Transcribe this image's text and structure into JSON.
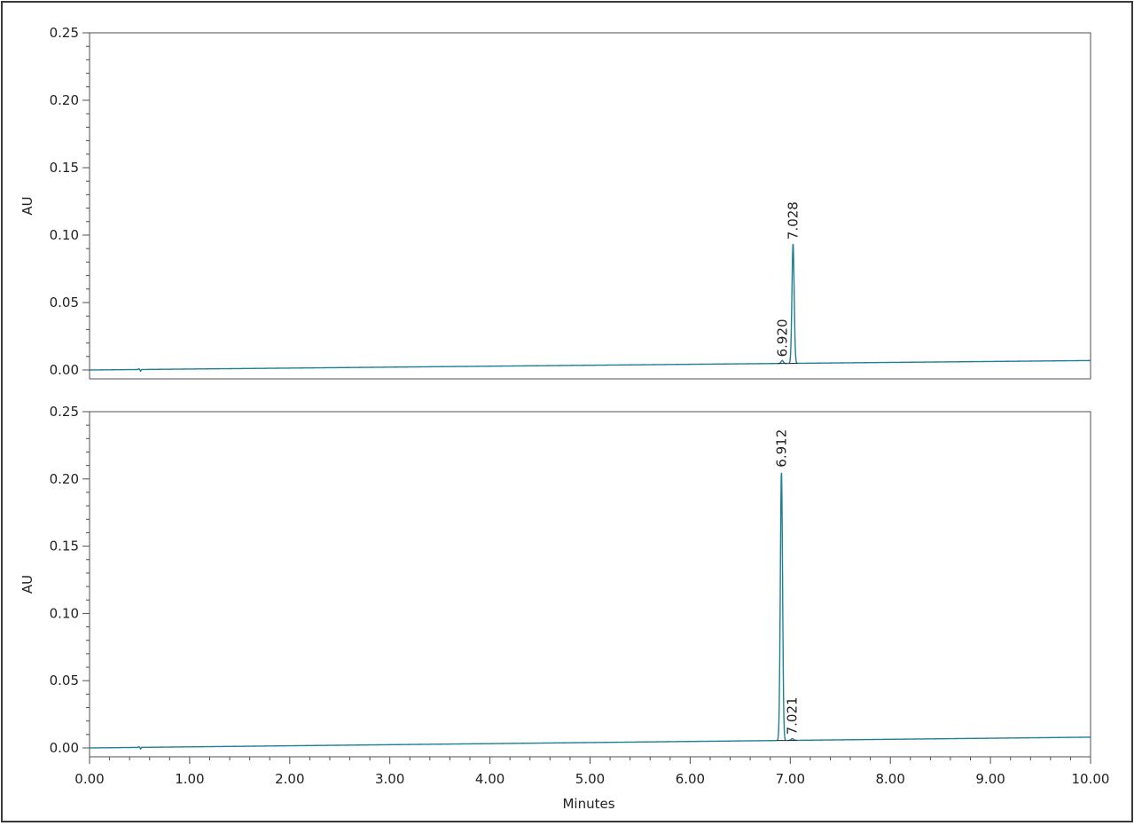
{
  "chart_data": [
    {
      "type": "line",
      "xlabel": "",
      "ylabel": "AU",
      "xlim": [
        0,
        10
      ],
      "ylim": [
        0,
        0.25
      ],
      "yticks": [
        "0.00",
        "0.05",
        "0.10",
        "0.15",
        "0.20",
        "0.25"
      ],
      "xticks": [],
      "grid": false,
      "baseline": {
        "start": 0.0,
        "end": 0.007
      },
      "injection_blip_minutes": 0.5,
      "peaks": [
        {
          "label": "6.920",
          "rt": 6.92,
          "height": 0.007
        },
        {
          "label": "7.028",
          "rt": 7.028,
          "height": 0.094
        }
      ],
      "series_color": "#1f7f96"
    },
    {
      "type": "line",
      "xlabel": "Minutes",
      "ylabel": "AU",
      "xlim": [
        0,
        10
      ],
      "ylim": [
        0,
        0.25
      ],
      "yticks": [
        "0.00",
        "0.05",
        "0.10",
        "0.15",
        "0.20",
        "0.25"
      ],
      "xticks": [
        "0.00",
        "1.00",
        "2.00",
        "3.00",
        "4.00",
        "5.00",
        "6.00",
        "7.00",
        "8.00",
        "9.00",
        "10.00"
      ],
      "grid": false,
      "baseline": {
        "start": 0.0,
        "end": 0.008
      },
      "injection_blip_minutes": 0.5,
      "peaks": [
        {
          "label": "6.912",
          "rt": 6.912,
          "height": 0.206
        },
        {
          "label": "7.021",
          "rt": 7.021,
          "height": 0.007
        }
      ],
      "series_color": "#1f7f96"
    }
  ]
}
